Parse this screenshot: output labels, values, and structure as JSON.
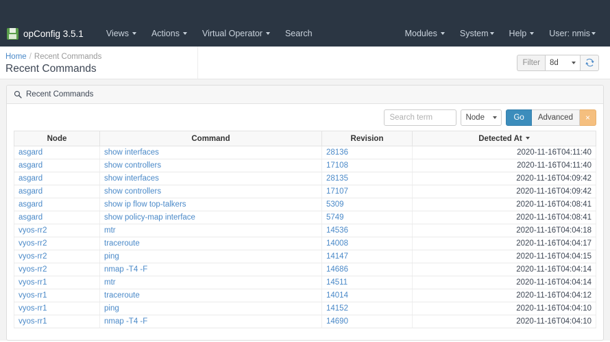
{
  "navbar": {
    "brand_icon": "save-disk-icon",
    "brand": "opConfig 3.5.1",
    "left_items": [
      {
        "label": "Views",
        "caret": true
      },
      {
        "label": "Actions",
        "caret": true
      },
      {
        "label": "Virtual Operator",
        "caret": true
      },
      {
        "label": "Search",
        "caret": false
      }
    ],
    "right_items": [
      {
        "label": "Modules",
        "caret": true
      },
      {
        "label": "System",
        "caret": true
      },
      {
        "label": "Help",
        "caret": true
      },
      {
        "label": "User: nmis",
        "caret": true
      }
    ]
  },
  "page_head": {
    "breadcrumb_home": "Home",
    "breadcrumb_sep": "/",
    "breadcrumb_current": "Recent Commands",
    "title": "Recent Commands",
    "filter_label": "Filter",
    "filter_value": "8d",
    "refresh_icon": "refresh-icon"
  },
  "panel": {
    "search_icon": "search-icon",
    "title": "Recent Commands"
  },
  "search_bar": {
    "search_placeholder": "Search term",
    "search_value": "",
    "field_select_value": "Node",
    "go_label": "Go",
    "advanced_label": "Advanced",
    "clear_label": "×"
  },
  "table": {
    "columns": [
      {
        "label": "Node",
        "sorted": false
      },
      {
        "label": "Command",
        "sorted": false
      },
      {
        "label": "Revision",
        "sorted": false
      },
      {
        "label": "Detected At",
        "sorted": true
      }
    ],
    "rows": [
      {
        "node": "asgard",
        "command": "show interfaces",
        "revision": "28136",
        "detected_at": "2020-11-16T04:11:40"
      },
      {
        "node": "asgard",
        "command": "show controllers",
        "revision": "17108",
        "detected_at": "2020-11-16T04:11:40"
      },
      {
        "node": "asgard",
        "command": "show interfaces",
        "revision": "28135",
        "detected_at": "2020-11-16T04:09:42"
      },
      {
        "node": "asgard",
        "command": "show controllers",
        "revision": "17107",
        "detected_at": "2020-11-16T04:09:42"
      },
      {
        "node": "asgard",
        "command": "show ip flow top-talkers",
        "revision": "5309",
        "detected_at": "2020-11-16T04:08:41"
      },
      {
        "node": "asgard",
        "command": "show policy-map interface",
        "revision": "5749",
        "detected_at": "2020-11-16T04:08:41"
      },
      {
        "node": "vyos-rr2",
        "command": "mtr",
        "revision": "14536",
        "detected_at": "2020-11-16T04:04:18"
      },
      {
        "node": "vyos-rr2",
        "command": "traceroute",
        "revision": "14008",
        "detected_at": "2020-11-16T04:04:17"
      },
      {
        "node": "vyos-rr2",
        "command": "ping",
        "revision": "14147",
        "detected_at": "2020-11-16T04:04:15"
      },
      {
        "node": "vyos-rr2",
        "command": "nmap -T4 -F",
        "revision": "14686",
        "detected_at": "2020-11-16T04:04:14"
      },
      {
        "node": "vyos-rr1",
        "command": "mtr",
        "revision": "14511",
        "detected_at": "2020-11-16T04:04:14"
      },
      {
        "node": "vyos-rr1",
        "command": "traceroute",
        "revision": "14014",
        "detected_at": "2020-11-16T04:04:12"
      },
      {
        "node": "vyos-rr1",
        "command": "ping",
        "revision": "14152",
        "detected_at": "2020-11-16T04:04:10"
      },
      {
        "node": "vyos-rr1",
        "command": "nmap -T4 -F",
        "revision": "14690",
        "detected_at": "2020-11-16T04:04:10"
      }
    ]
  },
  "colors": {
    "navbar_bg": "#2b3643",
    "link": "#4a89c8",
    "primary": "#3c8dbc",
    "warning": "#f5bf7f",
    "brand_green": "#5a9e4b"
  }
}
